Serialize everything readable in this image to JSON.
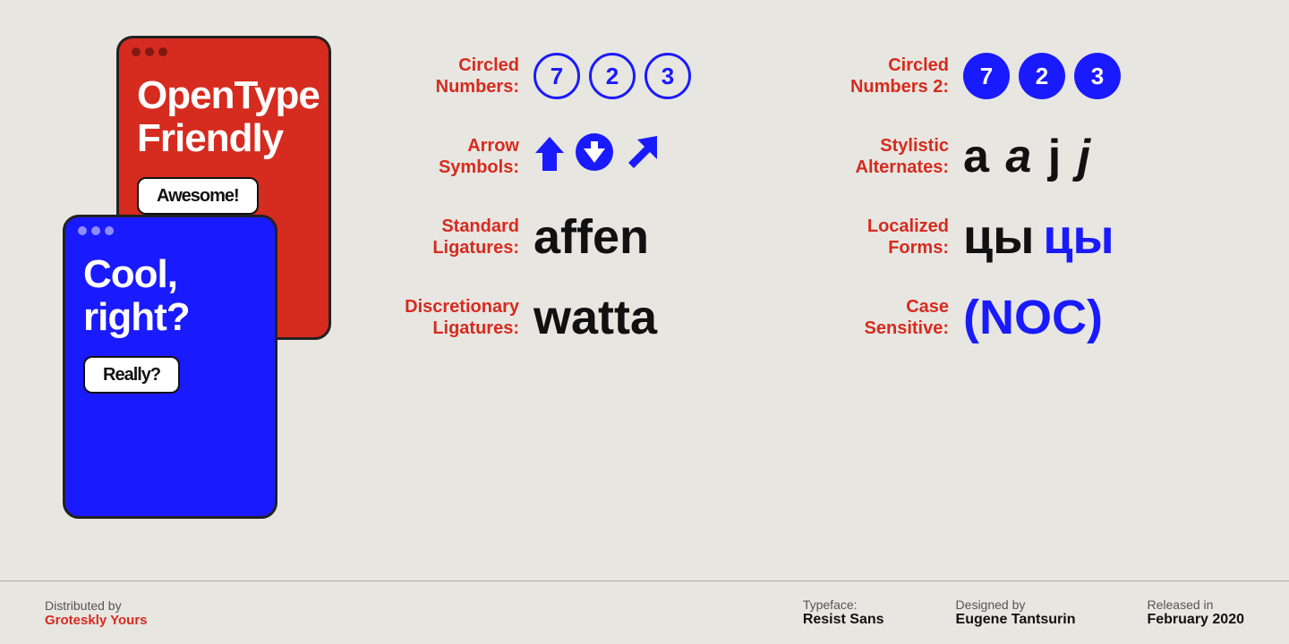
{
  "left_panel": {
    "phone_red": {
      "dots": [
        "dot1",
        "dot2",
        "dot3"
      ],
      "heading": "OpenType Friendly",
      "button_label": "Awesome!"
    },
    "phone_blue": {
      "dots": [
        "dot1",
        "dot2",
        "dot3"
      ],
      "heading": "Cool, right?",
      "button_label": "Really?"
    }
  },
  "features": [
    {
      "label": "Circled Numbers:",
      "type": "circled",
      "values": [
        "7",
        "2",
        "3"
      ],
      "style": "outline"
    },
    {
      "label": "Circled Numbers 2:",
      "type": "circled",
      "values": [
        "7",
        "2",
        "3"
      ],
      "style": "filled"
    },
    {
      "label": "Arrow Symbols:",
      "type": "arrows"
    },
    {
      "label": "Stylistic Alternates:",
      "type": "stylistic",
      "text": "a a j j"
    },
    {
      "label": "Standard Ligatures:",
      "type": "ligature",
      "text": "affen"
    },
    {
      "label": "Localized Forms:",
      "type": "localized",
      "text1": "цы",
      "text2": "цы"
    },
    {
      "label": "Discretionary Ligatures:",
      "type": "disc_ligature",
      "text": "watta"
    },
    {
      "label": "Case Sensitive:",
      "type": "case",
      "text": "(NOC)"
    }
  ],
  "footer": {
    "distributed_by_label": "Distributed by",
    "distributed_by_name": "Groteskly Yours",
    "typeface_label": "Typeface:",
    "typeface_value": "Resist Sans",
    "designed_by_label": "Designed by",
    "designed_by_value": "Eugene Tantsurin",
    "released_label": "Released in",
    "released_value": "February 2020"
  }
}
